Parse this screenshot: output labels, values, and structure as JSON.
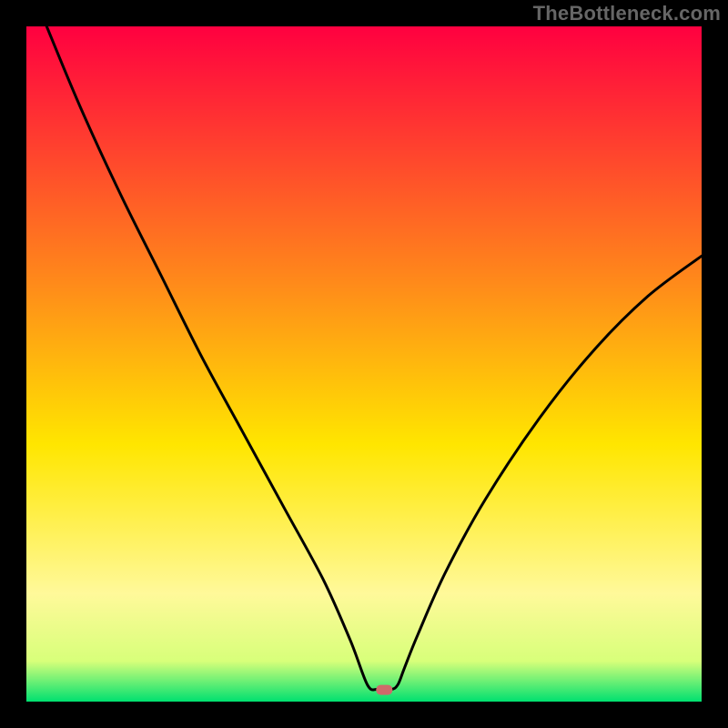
{
  "watermark": "TheBottleneck.com",
  "chart_data": {
    "type": "line",
    "title": "",
    "xlabel": "",
    "ylabel": "",
    "xlim": [
      0,
      100
    ],
    "ylim": [
      0,
      100
    ],
    "series": [
      {
        "name": "bottleneck-curve",
        "x": [
          3,
          8,
          14,
          20,
          26,
          32,
          38,
          44,
          48,
          50.5,
          52,
          54,
          55,
          56,
          58,
          62,
          68,
          76,
          84,
          92,
          100
        ],
        "y": [
          100,
          88,
          75,
          63,
          51,
          40,
          29,
          18,
          9,
          2.5,
          1.8,
          1.8,
          2.5,
          5,
          10,
          19,
          30,
          42,
          52,
          60,
          66
        ]
      }
    ],
    "annotations": [
      {
        "name": "optimum-marker",
        "x": 53,
        "y": 1.8
      }
    ],
    "background_gradient": {
      "top": "#ff0040",
      "mid": "#ffe600",
      "bottom": "#00e070"
    },
    "grid": false
  }
}
